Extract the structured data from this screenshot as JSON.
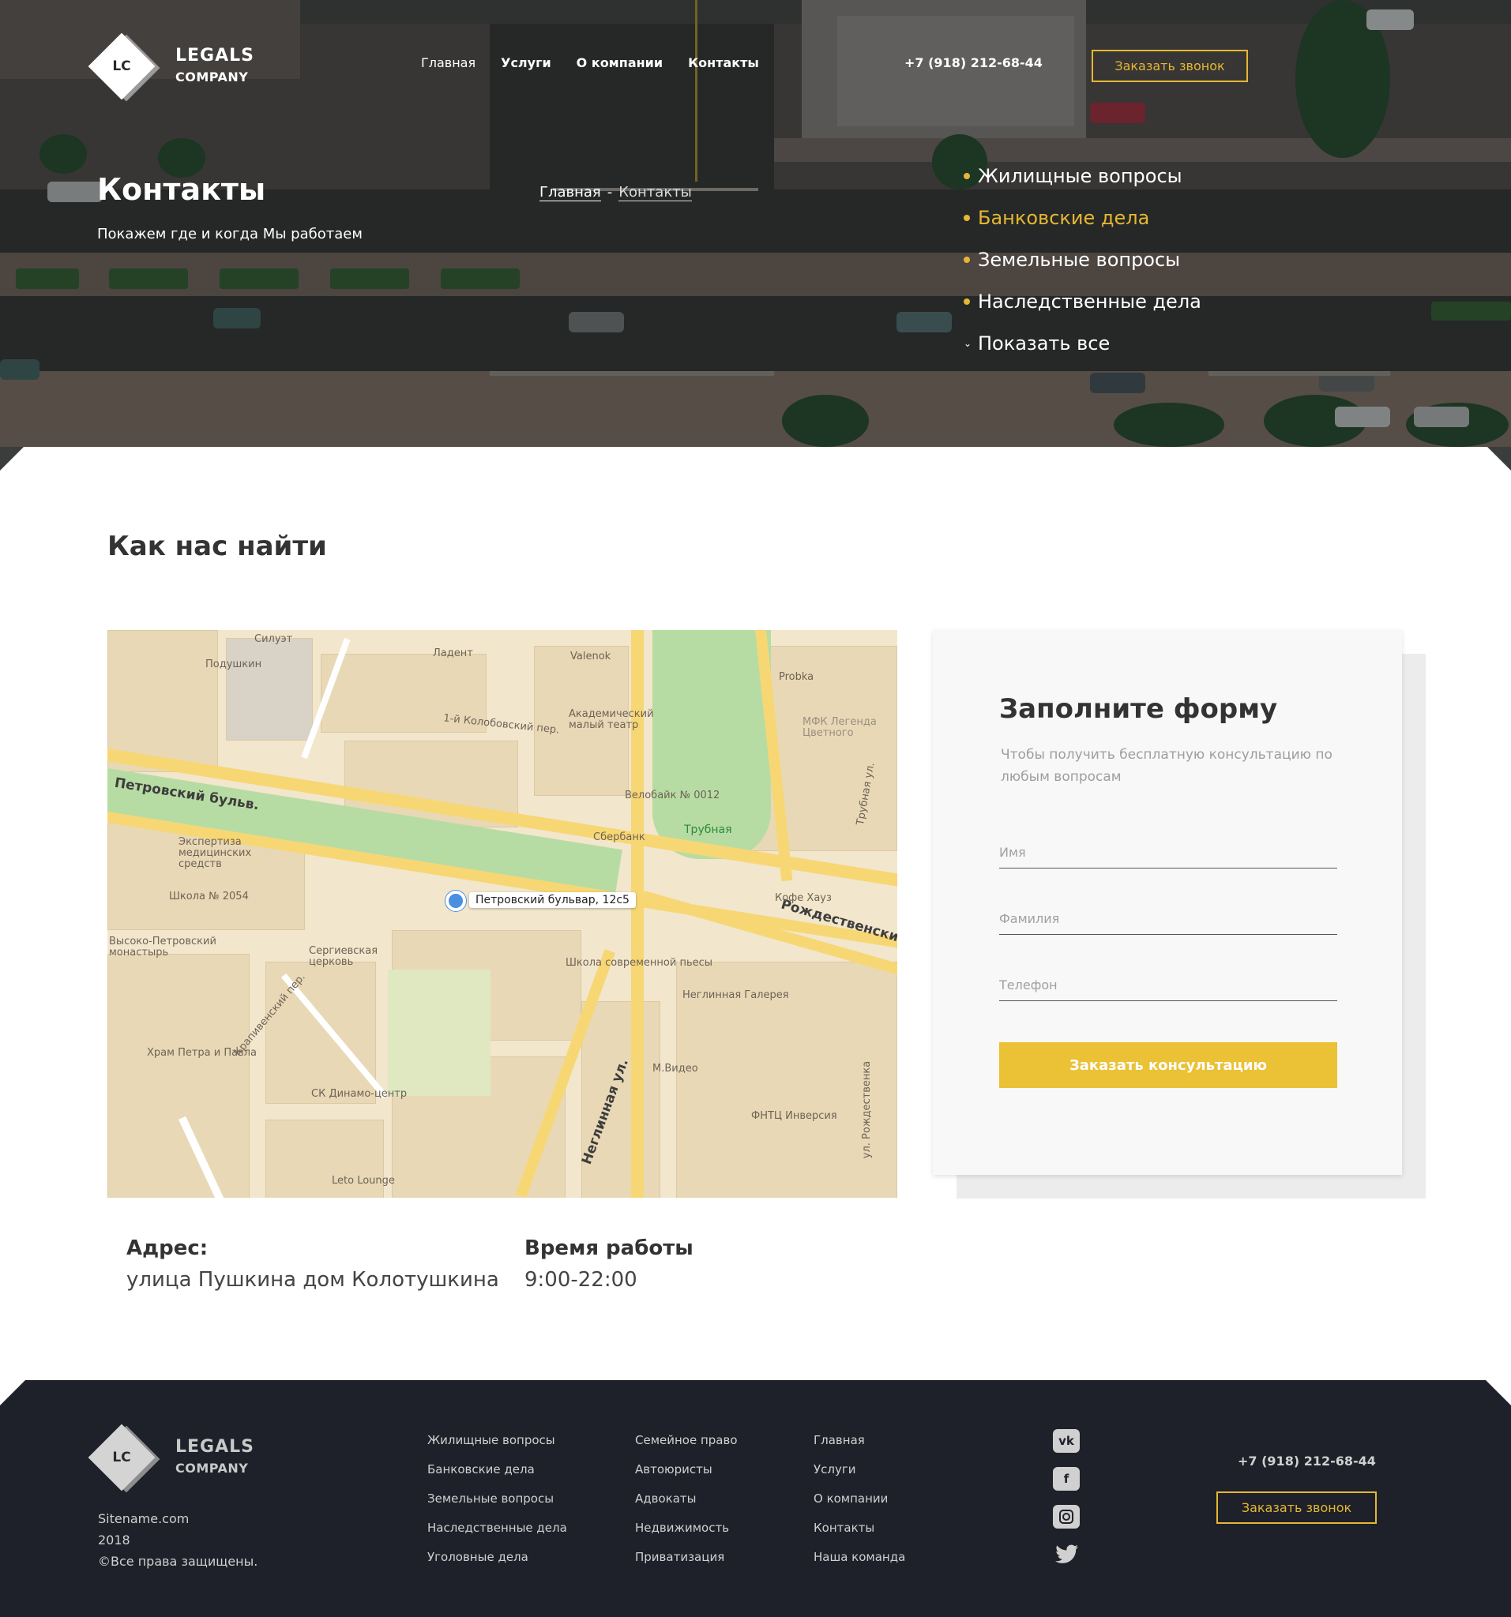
{
  "header": {
    "logo_mark": "LC",
    "logo_line1": "LEGALS",
    "logo_line2": "COMPANY",
    "nav": [
      "Главная",
      "Услуги",
      "О компании",
      "Контакты"
    ],
    "phone": "+7 (918) 212-68-44",
    "callback_button": "Заказать звонок"
  },
  "hero": {
    "title": "Контакты",
    "subtitle": "Покажем где и когда Мы работаем",
    "breadcrumb": {
      "home": "Главная",
      "separator": "-",
      "current": "Контакты"
    },
    "services": [
      "Жилищные вопросы",
      "Банковские дела",
      "Земельные вопросы",
      "Наследственные дела"
    ],
    "show_all": "Показать все"
  },
  "contacts": {
    "section_title": "Как нас найти",
    "map": {
      "pin_label": "Петровский бульвар, 12с5",
      "streets": [
        "Петровский бульв.",
        "Рождественский",
        "Неглинная ул.",
        "Трубная ул.",
        "1-й Колобовский пер.",
        "Крапивенский пер.",
        "ул. Рождественка"
      ],
      "places": [
        "Трубная",
        "Сбербанк",
        "Велобайк № 0012",
        "Школа современной пьесы",
        "Неглинная Галерея",
        "М.Видео",
        "СК Динамо-центр",
        "Leto Lounge",
        "Кофе Хауз",
        "ФНТЦ Инверсия",
        "Экспертиза медицинских средств",
        "Высоко-Петровский монастырь",
        "Храм Петра и Павла",
        "Сергиевская церковь",
        "Школа № 2054",
        "Академический малый театр",
        "Ладент",
        "Valenok",
        "Probka",
        "Подушкин",
        "Силуэт",
        "МФК Легенда Цветного"
      ]
    },
    "address_label": "Адрес:",
    "address_value": "улица Пушкина дом Колотушкина",
    "hours_label": "Время работы",
    "hours_value": "9:00-22:00"
  },
  "form": {
    "title": "Заполните форму",
    "subtitle": "Чтобы получить бесплатную консультацию по любым вопросам",
    "name_placeholder": "Имя",
    "surname_placeholder": "Фамилия",
    "phone_placeholder": "Телефон",
    "submit": "Заказать консультацию"
  },
  "footer": {
    "logo_mark": "LC",
    "logo_line1": "LEGALS",
    "logo_line2": "COMPANY",
    "site": "Sitename.com",
    "year": "2018",
    "rights": "©Все права защищены.",
    "col1": [
      "Жилищные вопросы",
      "Банковские дела",
      "Земельные вопросы",
      "Наследственные дела",
      "Уголовные дела"
    ],
    "col2": [
      "Семейное право",
      "Автоюристы",
      "Адвокаты",
      "Недвижимость",
      "Приватизация"
    ],
    "col3": [
      "Главная",
      "Услуги",
      "О компании",
      "Контакты",
      "Наша команда"
    ],
    "social": [
      "vk-icon",
      "facebook-icon",
      "instagram-icon",
      "twitter-icon"
    ],
    "phone": "+7 (918) 212-68-44",
    "callback_button": "Заказать звонок"
  },
  "colors": {
    "accent": "#ebc136",
    "dark": "#1e2129"
  }
}
